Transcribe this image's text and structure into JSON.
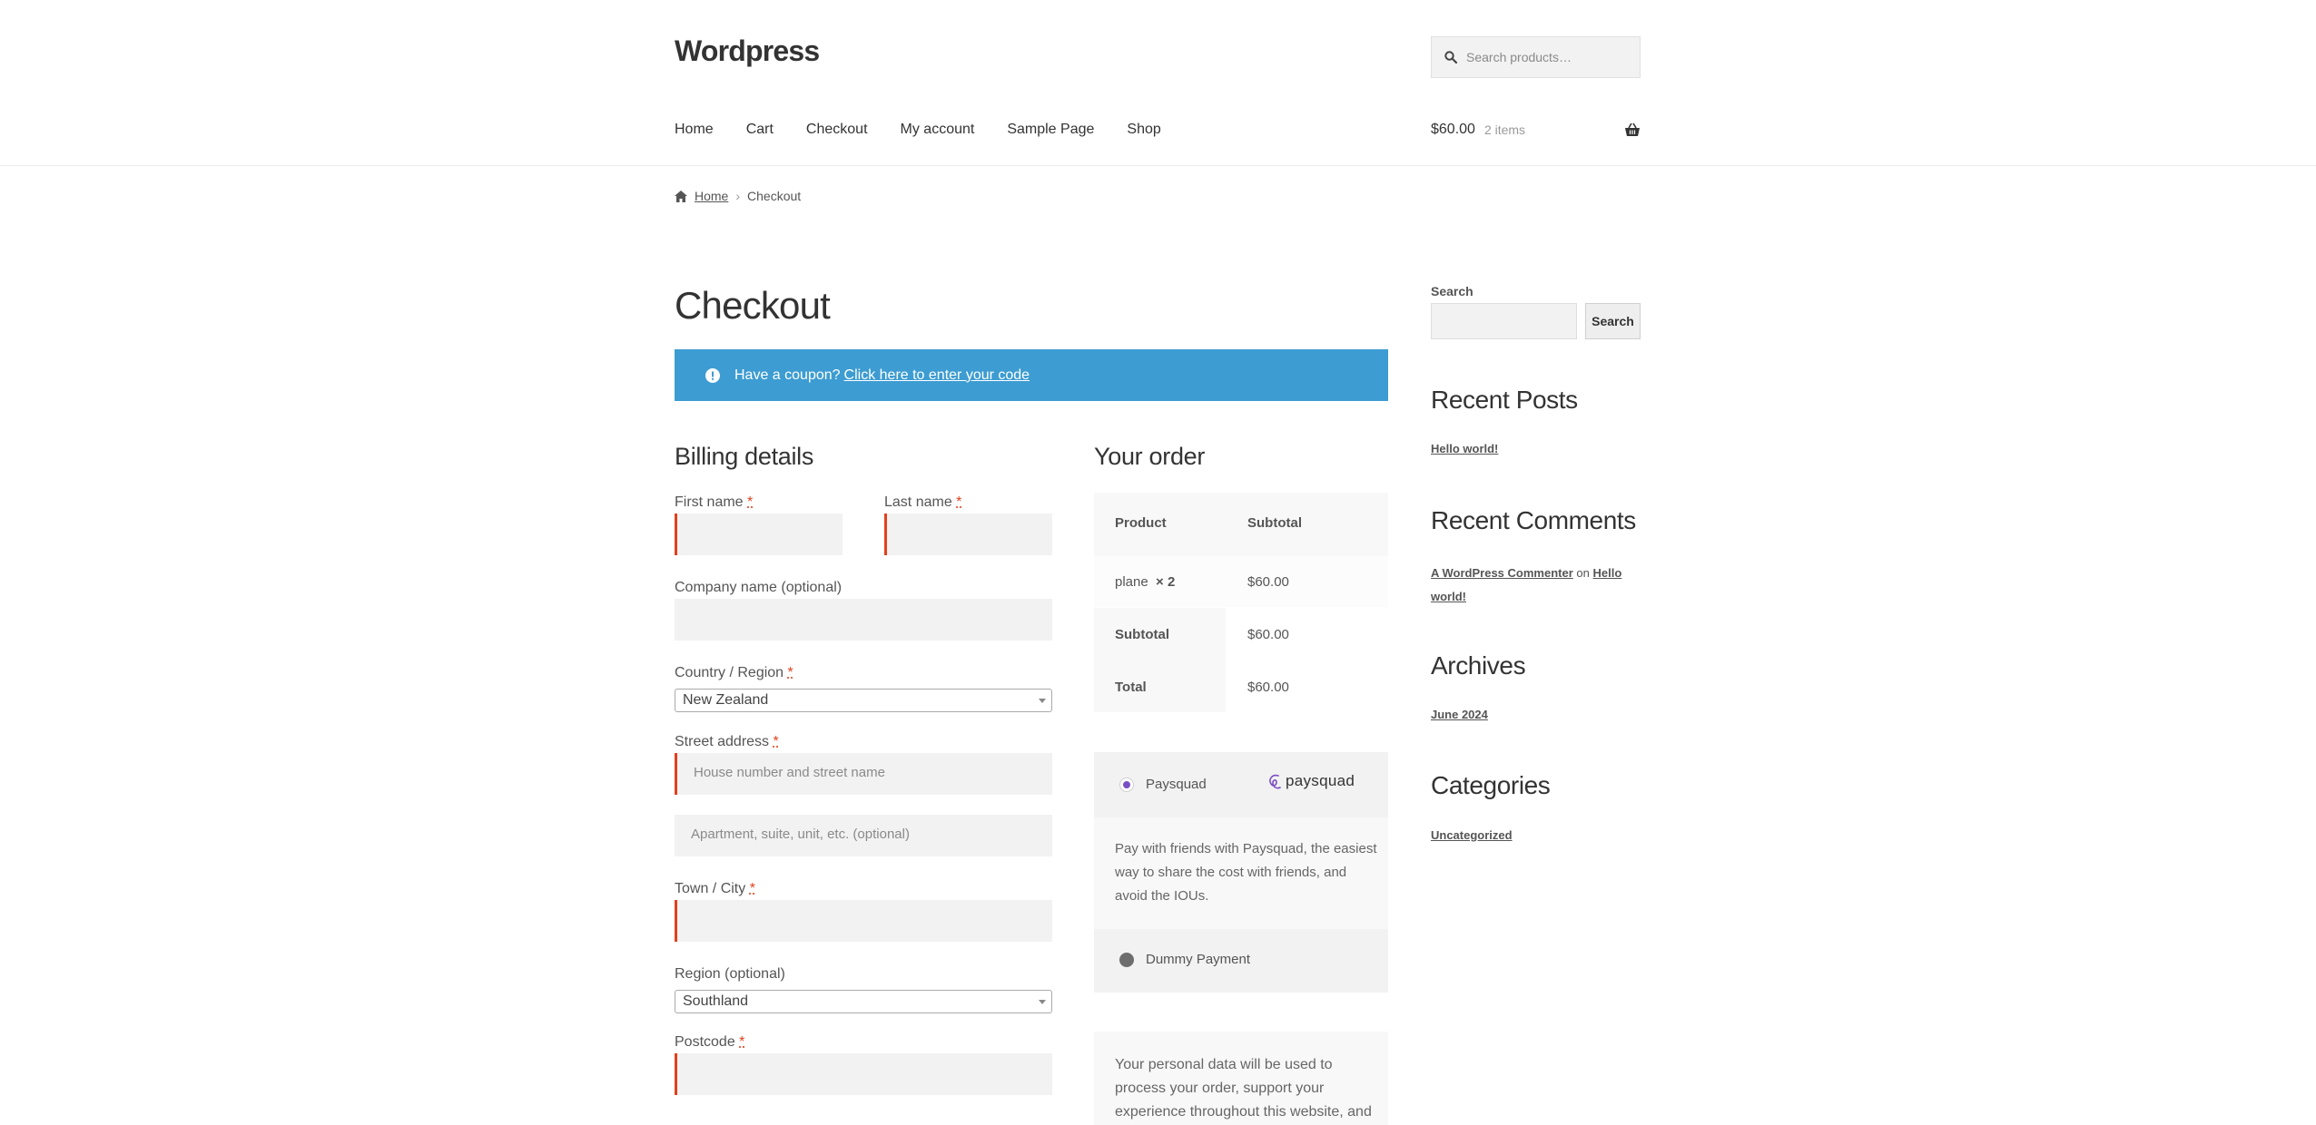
{
  "header": {
    "site_title": "Wordpress",
    "search_placeholder": "Search products…",
    "nav": [
      "Home",
      "Cart",
      "Checkout",
      "My account",
      "Sample Page",
      "Shop"
    ],
    "cart_amount": "$60.00",
    "cart_count": "2 items"
  },
  "breadcrumb": {
    "home": "Home",
    "current": "Checkout"
  },
  "page_title": "Checkout",
  "coupon": {
    "text": "Have a coupon?",
    "link": "Click here to enter your code"
  },
  "billing": {
    "title": "Billing details",
    "first_name": "First name",
    "last_name": "Last name",
    "company": "Company name (optional)",
    "country_label": "Country / Region",
    "country_value": "New Zealand",
    "street_label": "Street address",
    "street_placeholder": "House number and street name",
    "apt_placeholder": "Apartment, suite, unit, etc. (optional)",
    "city_label": "Town / City",
    "region_label": "Region (optional)",
    "region_value": "Southland",
    "postcode_label": "Postcode",
    "required_mark": "*"
  },
  "order": {
    "title": "Your order",
    "col_product": "Product",
    "col_subtotal": "Subtotal",
    "item_name": "plane",
    "item_qty": "× 2",
    "item_total": "$60.00",
    "subtotal_label": "Subtotal",
    "subtotal_value": "$60.00",
    "total_label": "Total",
    "total_value": "$60.00"
  },
  "payment": {
    "option1": "Paysquad",
    "option1_logo": "paysquad",
    "option1_desc": "Pay with friends with Paysquad, the easiest way to share the cost with friends, and avoid the IOUs.",
    "option2": "Dummy Payment"
  },
  "privacy": "Your personal data will be used to process your order, support your experience throughout this website, and for other",
  "sidebar": {
    "search_label": "Search",
    "search_button": "Search",
    "recent_posts_title": "Recent Posts",
    "recent_post": "Hello world!",
    "recent_comments_title": "Recent Comments",
    "comment_author": "A WordPress Commenter",
    "comment_on": "on",
    "comment_post_line1": "Hello",
    "comment_post_line2": "world!",
    "archives_title": "Archives",
    "archive_item": "June 2024",
    "categories_title": "Categories",
    "category_item": "Uncategorized"
  },
  "colors": {
    "notice_blue": "#3d9cd2",
    "required_red": "#e2401c",
    "paysquad_purple": "#7b4fc4"
  }
}
